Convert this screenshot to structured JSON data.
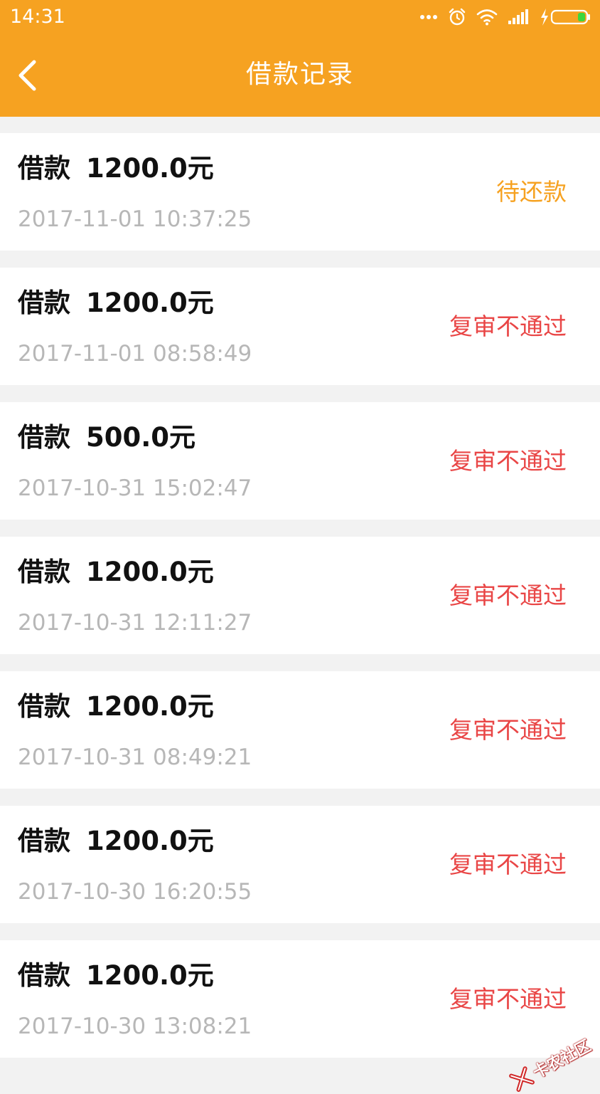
{
  "status_bar": {
    "time": "14:31"
  },
  "nav": {
    "title": "借款记录"
  },
  "records": [
    {
      "label": "借款",
      "amount": "1200.0元",
      "time": "2017-11-01 10:37:25",
      "status": "待还款",
      "status_color": "#f6a221"
    },
    {
      "label": "借款",
      "amount": "1200.0元",
      "time": "2017-11-01 08:58:49",
      "status": "复审不通过",
      "status_color": "#e94646"
    },
    {
      "label": "借款",
      "amount": "500.0元",
      "time": "2017-10-31 15:02:47",
      "status": "复审不通过",
      "status_color": "#e94646"
    },
    {
      "label": "借款",
      "amount": "1200.0元",
      "time": "2017-10-31 12:11:27",
      "status": "复审不通过",
      "status_color": "#e94646"
    },
    {
      "label": "借款",
      "amount": "1200.0元",
      "time": "2017-10-31 08:49:21",
      "status": "复审不通过",
      "status_color": "#e94646"
    },
    {
      "label": "借款",
      "amount": "1200.0元",
      "time": "2017-10-30 16:20:55",
      "status": "复审不通过",
      "status_color": "#e94646"
    },
    {
      "label": "借款",
      "amount": "1200.0元",
      "time": "2017-10-30 13:08:21",
      "status": "复审不通过",
      "status_color": "#e94646"
    }
  ],
  "watermark": {
    "text": "卡农社区"
  },
  "colors": {
    "header": "#f6a221",
    "background": "#f2f2f2",
    "card": "#ffffff",
    "timestamp": "#b7b7b7"
  }
}
